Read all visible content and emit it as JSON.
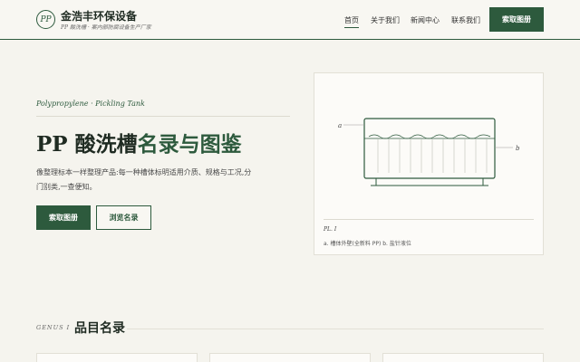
{
  "header": {
    "logo_text": "PP",
    "brand_name": "金浩丰环保设备",
    "brand_sub": "PP 酸洗槽 · 案内部防腐设备生产厂家",
    "nav": [
      {
        "label": "首页",
        "active": true
      },
      {
        "label": "关于我们",
        "active": false
      },
      {
        "label": "新闻中心",
        "active": false
      },
      {
        "label": "联系我们",
        "active": false
      }
    ],
    "cta_label": "索取图册"
  },
  "hero": {
    "eyebrow": "Polypropylene · Pickling Tank",
    "title_prefix": "PP 酸洗槽",
    "title_accent": "名录与图鉴",
    "desc": "像整理标本一样整理产品:每一种槽体标明适用介质、规格与工况,分门别类,一查便知。",
    "btn_primary": "索取图册",
    "btn_secondary": "浏览名录"
  },
  "figure": {
    "mark_a": "a",
    "mark_b": "b",
    "plate_label": "PL. I",
    "caption": "a. 槽体外壁(全新料 PP) b. 盐针液位"
  },
  "section": {
    "kicker": "GENUS I",
    "title": "品目名录"
  }
}
